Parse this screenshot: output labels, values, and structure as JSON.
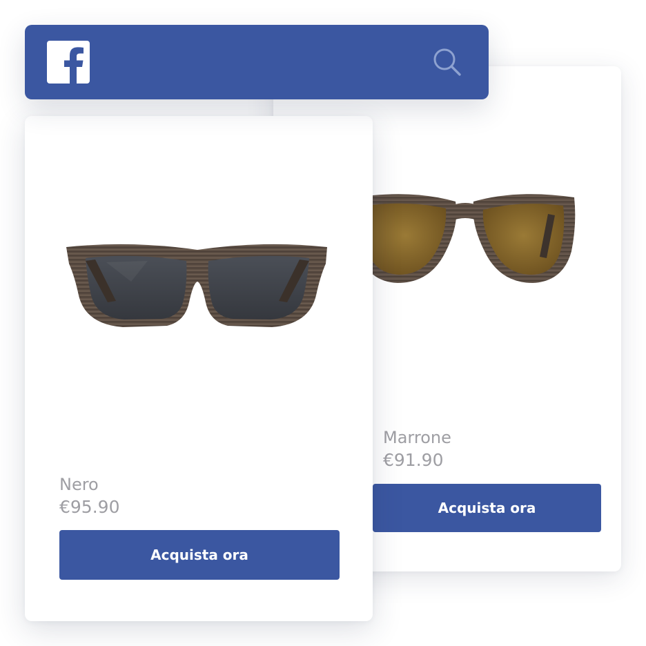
{
  "brand": {
    "logo_icon": "facebook-logo-icon",
    "color": "#3b57a1"
  },
  "header": {
    "search_icon": "search-icon"
  },
  "products": [
    {
      "name": "Nero",
      "price": "€95.90",
      "cta": "Acquista ora",
      "lens_color": "#3f434b",
      "frame_color": "#5b4d43"
    },
    {
      "name": "Marrone",
      "price": "€91.90",
      "cta": "Acquista ora",
      "lens_color": "#8a6a2c",
      "frame_color": "#5b4d43"
    }
  ],
  "colors": {
    "accent": "#3b57a1",
    "muted_text": "#9e9ea3",
    "card_bg": "#ffffff"
  }
}
